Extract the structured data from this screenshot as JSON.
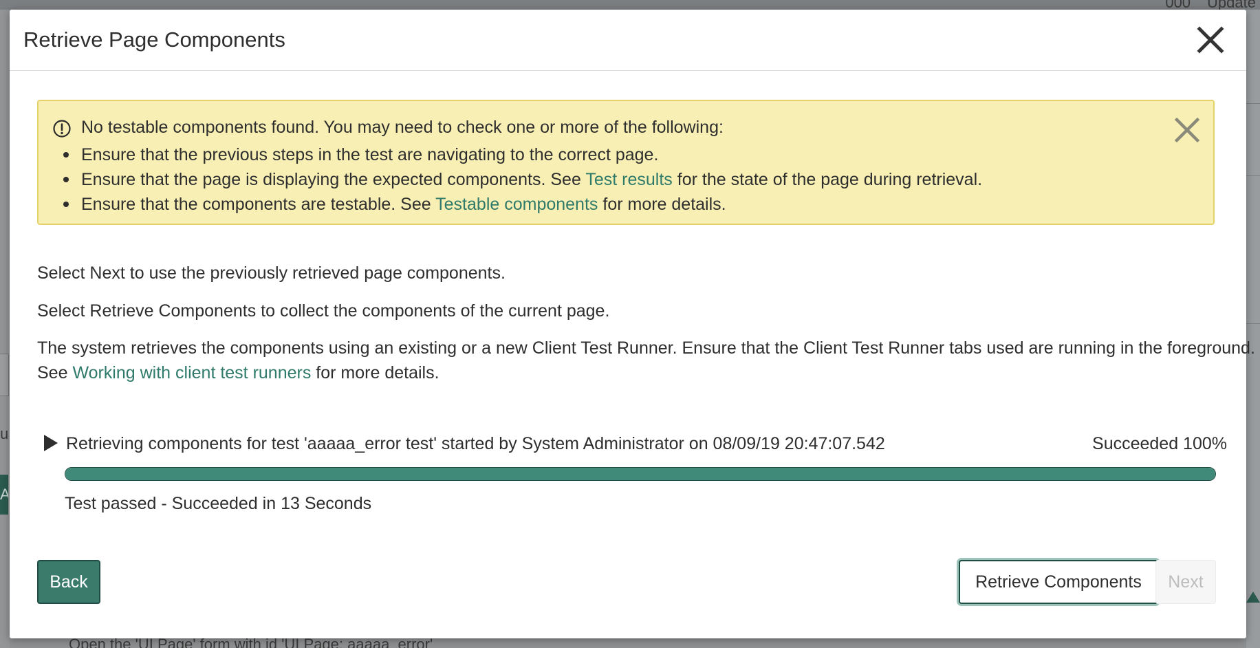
{
  "background": {
    "top_right_text": "Update",
    "top_right_count": "000",
    "left_tab_letter": "A",
    "left_text_fragment": "ua",
    "bottom_text": "Open the 'UI Page' form with id 'UI Page: aaaaa_error'"
  },
  "modal": {
    "title": "Retrieve Page Components",
    "close_icon": "close-icon"
  },
  "alert": {
    "icon": "exclamation-circle-icon",
    "message": "No testable components found. You may need to check one or more of the following:",
    "items": [
      {
        "before": "Ensure that the previous steps in the test are navigating to the correct page.",
        "link": "",
        "after": ""
      },
      {
        "before": "Ensure that the page is displaying the expected components. See ",
        "link": "Test results",
        "after": " for the state of the page during retrieval."
      },
      {
        "before": "Ensure that the components are testable. See ",
        "link": "Testable components",
        "after": " for more details."
      }
    ],
    "colors": {
      "background": "#f8efb4",
      "border": "#e5d36a"
    }
  },
  "body": {
    "p1": "Select Next to use the previously retrieved page components.",
    "p2": "Select Retrieve Components to collect the components of the current page.",
    "p3_line1": "The system retrieves the components using an existing or a new Client Test Runner. Ensure that the Client Test Runner tabs used are running in the foreground.",
    "p3_see": "See ",
    "p3_link": "Working with client test runners",
    "p3_after": " for more details."
  },
  "progress": {
    "toggle_icon": "play-triangle-icon",
    "label": "Retrieving components for test 'aaaaa_error test' started by System Administrator on 08/09/19 20:47:07.542",
    "status": "Succeeded 100%",
    "percent": 100,
    "result": "Test passed - Succeeded in 13 Seconds",
    "color": "#3f8a78"
  },
  "footer": {
    "back_label": "Back",
    "retrieve_label": "Retrieve Components",
    "next_label": "Next"
  },
  "colors": {
    "accent": "#3b7b6c",
    "link": "#2f7a6a"
  }
}
